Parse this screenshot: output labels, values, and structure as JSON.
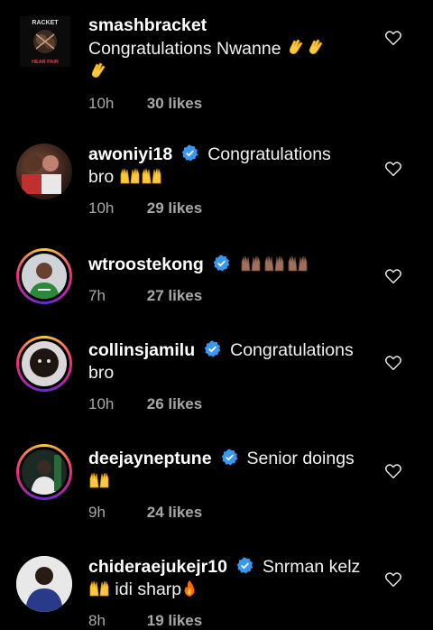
{
  "comments": [
    {
      "username": "smashbracket",
      "verified": false,
      "text_line1": "Congratulations Nwanne",
      "emoji_line1": [
        "clap",
        "clap"
      ],
      "emoji_line2": [
        "clap"
      ],
      "time": "10h",
      "likes": "30 likes",
      "avatar_logo_text": "RACKET",
      "avatar_logo_sub": "HEAR PAIR"
    },
    {
      "username": "awoniyi18",
      "verified": true,
      "text_line1": "Congratulations",
      "text_line2": "bro",
      "emoji_line2": [
        "raising-hands",
        "raising-hands"
      ],
      "time": "10h",
      "likes": "29 likes"
    },
    {
      "username": "wtroostekong",
      "verified": true,
      "text_line1": "",
      "emoji_line1": [
        "raising-hands-brown",
        "raising-hands-brown",
        "raising-hands-brown"
      ],
      "time": "7h",
      "likes": "27 likes"
    },
    {
      "username": "collinsjamilu",
      "verified": true,
      "text_line1": "Congratulations",
      "text_line2": "bro",
      "time": "10h",
      "likes": "26 likes"
    },
    {
      "username": "deejayneptune",
      "verified": true,
      "text_line1": "Senior doings",
      "emoji_line2": [
        "raising-hands"
      ],
      "time": "9h",
      "likes": "24 likes"
    },
    {
      "username": "chideraejukejr10",
      "verified": true,
      "text_line1": "Snrman kelz",
      "text_line2": "idi sharp",
      "emoji_line2_before": [
        "raising-hands"
      ],
      "emoji_line2_after": [
        "fire"
      ],
      "time": "8h",
      "likes": "19 likes"
    }
  ],
  "colors": {
    "background": "#000000",
    "verified_badge": "#3897f0",
    "meta_text": "#a8a8a8",
    "emoji_yellow": "#ffc83d",
    "emoji_brown": "#a0705a",
    "fire": "#ff6a00"
  },
  "icons": {
    "like": "heart-outline-icon",
    "verified": "verified-badge-icon"
  }
}
